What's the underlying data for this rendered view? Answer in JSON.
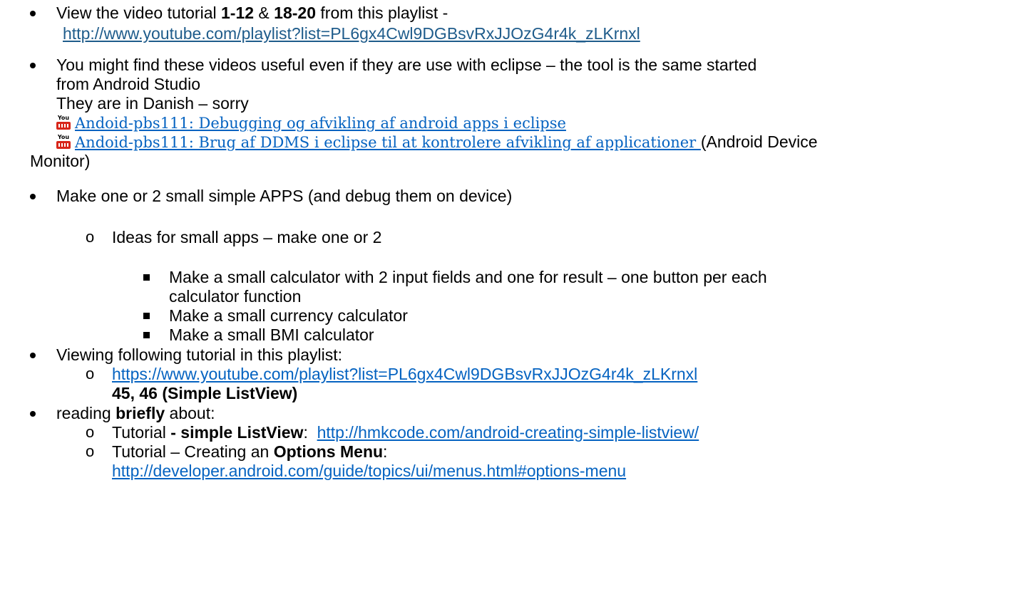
{
  "items": {
    "b1": {
      "prefix": "View the video tutorial ",
      "bold1": "1-12",
      "mid": " & ",
      "bold2": "18-20",
      "suffix": " from this playlist -",
      "link": "http://www.youtube.com/playlist?list=PL6gx4Cwl9DGBsvRxJJOzG4r4k_zLKrnxl"
    },
    "b2": {
      "line1": "You might find these videos useful even if they are use with eclipse – the tool is the same started",
      "line2": "from Android Studio",
      "line3": "They are in Danish – sorry",
      "video1": "Andoid-pbs111: Debugging og afvikling af android apps i eclipse",
      "video2": "Andoid-pbs111: Brug af DDMS i eclipse til at kontrolere afvikling af applicationer ",
      "video2_suffix": "(Android Device",
      "line_monitor": "Monitor)",
      "icon_top": "You",
      "icon_bottom": "Tube"
    },
    "b3": {
      "text": "Make one or 2 small simple APPS (and debug them on device)",
      "sub": "Ideas for small apps – make one or 2",
      "ideas": [
        "Make a small calculator with 2 input fields and one for result – one button per each",
        "calculator function",
        "Make a small currency calculator",
        "Make a small BMI calculator"
      ]
    },
    "b4": {
      "text": "Viewing following tutorial in this playlist:",
      "link": "https://www.youtube.com/playlist?list=PL6gx4Cwl9DGBsvRxJJOzG4r4k_zLKrnxl",
      "bold": "45, 46 (Simple ListView)"
    },
    "b5": {
      "prefix": "reading ",
      "bold": "briefly",
      "suffix": " about:",
      "t1_prefix": "Tutorial ",
      "t1_bold": "- simple ListView",
      "t1_colon": ":  ",
      "t1_link": "http://hmkcode.com/android-creating-simple-listview/",
      "t2_prefix": "Tutorial – Creating an ",
      "t2_bold": "Options Menu",
      "t2_colon": ":",
      "t2_link": "http://developer.android.com/guide/topics/ui/menus.html#options-menu"
    }
  }
}
